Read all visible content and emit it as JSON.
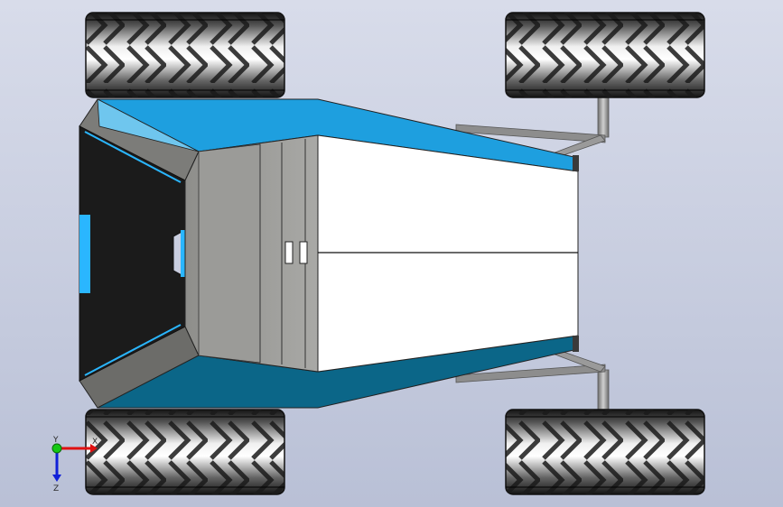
{
  "scene": {
    "subject": "rover-vehicle-top-view",
    "colors": {
      "background_top": "#d8dcea",
      "background_bottom": "#b9c0d6",
      "body_blue": "#1e9fdf",
      "body_blue_dark": "#0a5f80",
      "body_white": "#ffffff",
      "body_gray": "#9e9e9a",
      "cockpit_black": "#1b1b1b",
      "tire_dark": "#1f1f1f",
      "tire_light": "#e8e8e8",
      "strut_gray": "#8d8d8d"
    }
  },
  "triad": {
    "x_label": "X",
    "y_label": "Y",
    "z_label": "Z",
    "colors": {
      "x": "#e01010",
      "y": "#14c814",
      "z": "#1020d8"
    }
  }
}
